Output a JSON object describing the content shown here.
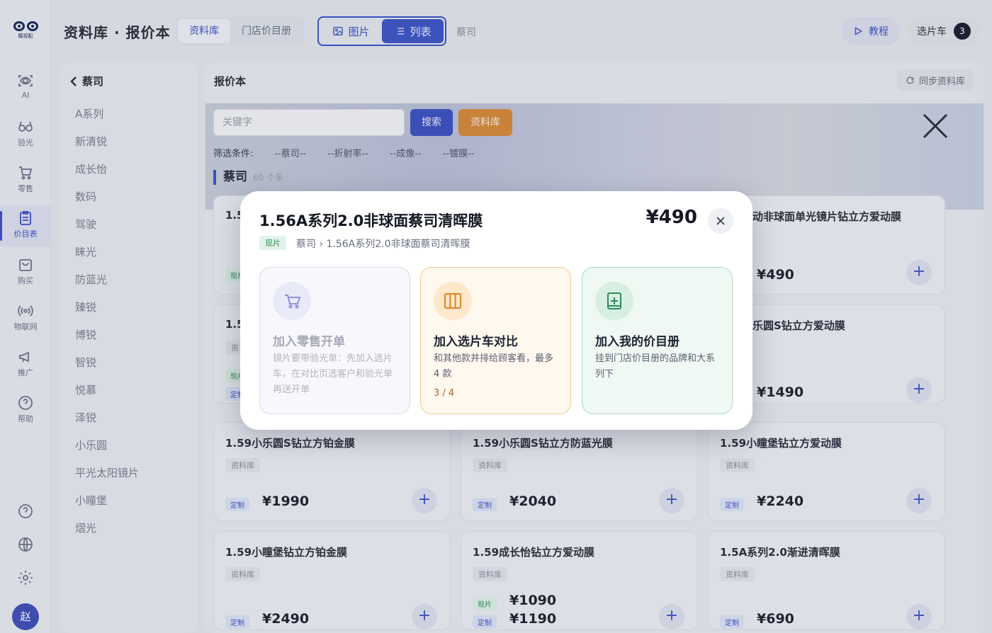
{
  "logo": {
    "text": "瞳视配"
  },
  "rail": {
    "items": [
      {
        "label": "AI",
        "icon": "ai-eye-icon"
      },
      {
        "label": "验光",
        "icon": "glasses-icon"
      },
      {
        "label": "零售",
        "icon": "cart-icon"
      },
      {
        "label": "价目表",
        "icon": "price-list-icon",
        "active": true
      },
      {
        "label": "购买",
        "icon": "bag-icon"
      },
      {
        "label": "物联网",
        "icon": "broadcast-icon"
      },
      {
        "label": "推广",
        "icon": "megaphone-icon"
      },
      {
        "label": "帮助",
        "icon": "help-icon"
      }
    ],
    "avatar": "赵"
  },
  "topbar": {
    "brand": "资料库 · 报价本",
    "seg": [
      "资料库",
      "门店价目册"
    ],
    "view_image": "图片",
    "view_list": "列表",
    "crumb": "蔡司",
    "tutorial": "教程",
    "cart": "选片车",
    "cart_count": "3"
  },
  "sidebar": {
    "back_label": "蔡司",
    "items": [
      "A系列",
      "新清锐",
      "成长怡",
      "数码",
      "驾驶",
      "睐光",
      "防蓝光",
      "臻锐",
      "博锐",
      "智锐",
      "悦慕",
      "泽锐",
      "小乐圆",
      "平光太阳镜片",
      "小瞳堡",
      "熠光"
    ]
  },
  "main": {
    "title": "报价本",
    "sync": "同步资料库",
    "search_placeholder": "关键字",
    "search_btn": "搜索",
    "lib_btn": "资料库",
    "filter_label": "筛选条件:",
    "filters": [
      "--蔡司--",
      "--折射率--",
      "--成像--",
      "--镀膜--"
    ],
    "section": "蔡司",
    "section_count": "60 个系"
  },
  "cards": [
    {
      "title": "1.5",
      "tag": "",
      "prices": [
        {
          "type": "现片",
          "value": ""
        }
      ]
    },
    {
      "title": "动非球面单光镜片钻立方爱动膜",
      "tag": "",
      "prices": [
        {
          "type": "",
          "value": "¥490"
        }
      ]
    },
    {
      "title": "1.5",
      "tag": "资",
      "prices": [
        {
          "type": "现片",
          "value": ""
        },
        {
          "type": "定制",
          "value": ""
        }
      ]
    },
    {
      "title": "乐圆S钻立方爱动膜",
      "tag": "",
      "prices": [
        {
          "type": "",
          "value": "¥1490"
        }
      ]
    },
    {
      "title": "1.59小乐圆S钻立方铂金膜",
      "tag": "资料库",
      "prices": [
        {
          "type": "定制",
          "value": "¥1990"
        }
      ]
    },
    {
      "title": "1.59小乐圆S钻立方防蓝光膜",
      "tag": "资料库",
      "prices": [
        {
          "type": "定制",
          "value": "¥2040"
        }
      ]
    },
    {
      "title": "1.59小瞳堡钻立方爱动膜",
      "tag": "资料库",
      "prices": [
        {
          "type": "定制",
          "value": "¥2240"
        }
      ]
    },
    {
      "title": "1.59小瞳堡钻立方铂金膜",
      "tag": "资料库",
      "prices": [
        {
          "type": "定制",
          "value": "¥2490"
        }
      ]
    },
    {
      "title": "1.59成长怡钻立方爱动膜",
      "tag": "资料库",
      "prices": [
        {
          "type": "现片",
          "value": "¥1090"
        },
        {
          "type": "定制",
          "value": "¥1190"
        }
      ]
    },
    {
      "title": "1.5A系列2.0渐进清晖膜",
      "tag": "资料库",
      "prices": [
        {
          "type": "定制",
          "value": "¥690"
        }
      ]
    }
  ],
  "modal": {
    "title": "1.56A系列2.0非球面蔡司清晖膜",
    "price": "¥490",
    "tag": "现片",
    "crumb": "蔡司 › 1.56A系列2.0非球面蔡司清晖膜",
    "options": [
      {
        "title": "加入零售开单",
        "desc": "镜片要带验光单：先加入选片车，在对比页选客户和验光单再送开单",
        "icon": "cart-icon",
        "enabled": false
      },
      {
        "title": "加入选片车对比",
        "desc": "和其他款并排给顾客看，最多 4 款",
        "count": "3 / 4",
        "icon": "columns-icon",
        "enabled": true
      },
      {
        "title": "加入我的价目册",
        "desc": "挂到门店价目册的品牌和大系列下",
        "icon": "book-add-icon",
        "enabled": true
      }
    ]
  },
  "colors": {
    "accent": "#3f56c7",
    "orange": "#d6893a",
    "green": "#2f8a57"
  }
}
